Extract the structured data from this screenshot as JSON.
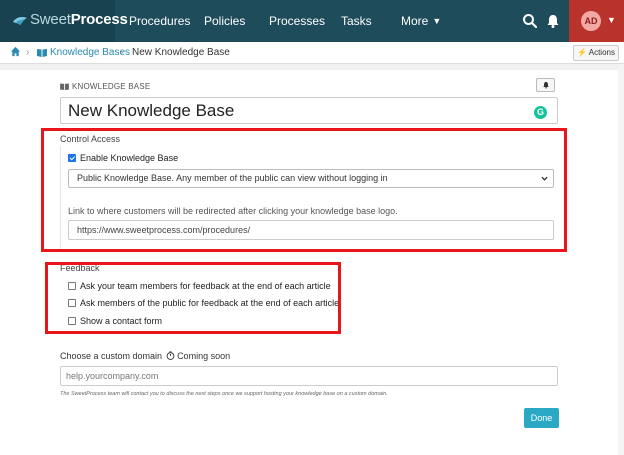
{
  "app": {
    "logo_word1": "Sweet",
    "logo_word2": "Process"
  },
  "nav": {
    "items": [
      {
        "label": "Procedures"
      },
      {
        "label": "Policies"
      },
      {
        "label": "Processes"
      },
      {
        "label": "Tasks"
      },
      {
        "label": "More"
      }
    ],
    "user_initials": "AD"
  },
  "breadcrumb": {
    "parent": "Knowledge Bases",
    "current": "New Knowledge Base",
    "separator": "›"
  },
  "toolbar": {
    "actions_label": "Actions"
  },
  "form": {
    "section_label": "KNOWLEDGE BASE",
    "title_value": "New Knowledge Base",
    "control_access": {
      "label": "Control Access",
      "enable_label": "Enable Knowledge Base",
      "enable_checked": true,
      "access_selected": "Public Knowledge Base. Any member of the public can view without logging in",
      "redirect_help": "Link to where customers will be redirected after clicking your knowledge base logo.",
      "redirect_value": "https://www.sweetprocess.com/procedures/"
    },
    "feedback": {
      "label": "Feedback",
      "options": [
        {
          "label": "Ask your team members for feedback at the end of each article",
          "checked": false
        },
        {
          "label": "Ask members of the public for feedback at the end of each article",
          "checked": false
        },
        {
          "label": "Show a contact form",
          "checked": false
        }
      ]
    },
    "domain": {
      "label": "Choose a custom domain",
      "coming_soon": "Coming soon",
      "placeholder": "help.yourcompany.com",
      "note": "The SweetProcess team will contact you to discuss the next steps once we support hosting your knowledge base on a custom domain."
    },
    "done_label": "Done"
  },
  "colors": {
    "nav_bg": "#1e4c5b",
    "avatar_bg": "#b9332d",
    "link": "#2a8ab0",
    "done_button": "#2aa8c4",
    "highlight": "#e8161b"
  }
}
